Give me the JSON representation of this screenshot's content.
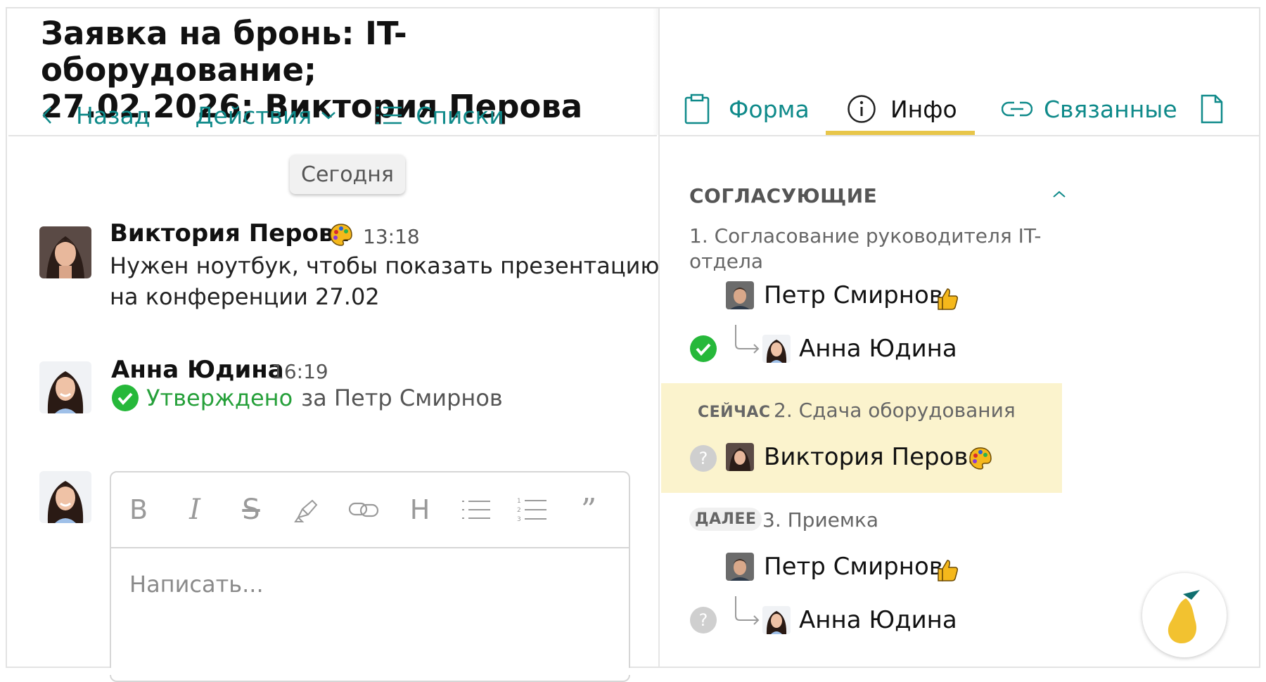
{
  "header": {
    "title_line1": "Заявка на бронь: IT-оборудование;",
    "title_line2": "27.02.2026; Виктория Перова",
    "back_label": "Назад",
    "actions_label": "Действия",
    "lists_label": "Списки"
  },
  "tabs": [
    {
      "label": "Форма",
      "icon": "clipboard-icon"
    },
    {
      "label": "Инфо",
      "icon": "info-icon"
    },
    {
      "label": "Связанные",
      "icon": "link-icon"
    },
    {
      "label": "",
      "icon": "document-icon"
    }
  ],
  "feed": {
    "date_separator": "Сегодня",
    "messages": [
      {
        "author": "Виктория Перова",
        "time": "13:18",
        "text_line1": "Нужен ноутбук, чтобы показать презентацию",
        "text_line2": "на конференции 27.02"
      },
      {
        "author": "Анна Юдина",
        "time": "16:19",
        "status_word": "Утверждено",
        "status_rest": "за Петр Смирнов"
      }
    ]
  },
  "editor": {
    "placeholder": "Написать...",
    "toolbar": [
      "B",
      "I",
      "S",
      "highlight",
      "link",
      "H",
      "bullets",
      "numbered",
      "quote"
    ]
  },
  "approvers": {
    "section_title": "СОГЛАСУЮЩИЕ",
    "steps": [
      {
        "title_line1": "1. Согласование руководителя IT-",
        "title_line2": "отдела",
        "approver": "Петр Смирнов",
        "delegate": "Анна Юдина",
        "status": "approved"
      },
      {
        "badge": "СЕЙЧАС",
        "title": "2. Сдача оборудования",
        "approver": "Виктория Перова",
        "status": "pending"
      },
      {
        "badge": "ДАЛЕЕ",
        "title": "3. Приемка",
        "approver": "Петр Смирнов",
        "delegate": "Анна Юдина",
        "status": "pending"
      }
    ]
  },
  "colors": {
    "accent": "#0f8a8a",
    "approved_green": "#26a03a",
    "current_step_bg": "#fbf3cd",
    "tab_underline": "#e8c64a"
  }
}
